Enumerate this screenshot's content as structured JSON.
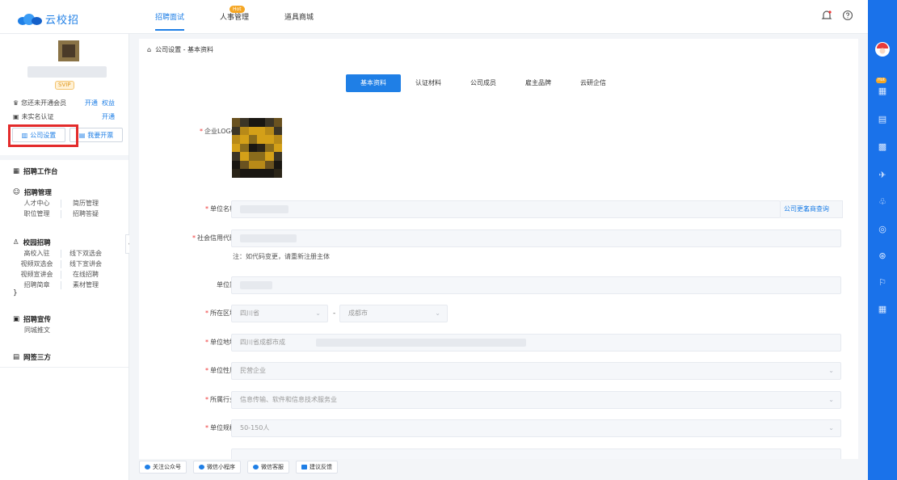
{
  "app": {
    "logo_text": "云校招"
  },
  "topnav": {
    "items": [
      {
        "label": "招聘面试",
        "active": true
      },
      {
        "label": "人事管理",
        "badge": "Hot"
      },
      {
        "label": "道具商城"
      }
    ]
  },
  "sidebar": {
    "svip_badge": "SVIP",
    "membership": {
      "label": "您还未开通会员",
      "action1": "开通",
      "action2": "权益"
    },
    "realname": {
      "label": "未实名认证",
      "action": "开通"
    },
    "btn_company": "公司设置",
    "btn_invoice": "我要开票",
    "sections": [
      {
        "title": "招聘工作台",
        "items": []
      },
      {
        "title": "招聘管理",
        "items": [
          "人才中心",
          "简历管理",
          "职位管理",
          "招聘答疑"
        ]
      },
      {
        "title": "校园招聘",
        "items": [
          "高校入驻",
          "线下双选会",
          "视频双选会",
          "线下宣讲会",
          "视频宣讲会",
          "在线招聘",
          "招聘简章",
          "素材管理"
        ]
      },
      {
        "title": "招聘宣传",
        "items": [
          "同城推文"
        ]
      },
      {
        "title": "网签三方",
        "items": []
      }
    ]
  },
  "breadcrumb": "公司设置 - 基本资料",
  "tabs": [
    {
      "label": "基本资料",
      "active": true
    },
    {
      "label": "认证材料"
    },
    {
      "label": "公司成员"
    },
    {
      "label": "雇主品牌"
    },
    {
      "label": "云研企信"
    }
  ],
  "form": {
    "logo_label": "企业LOGO",
    "name": {
      "label": "单位名称",
      "link1": "公司更名",
      "link2": "工商查询"
    },
    "credit": {
      "label": "社会信用代码",
      "hint": "注：如代码变更，请重新注册主体"
    },
    "short": {
      "label": "单位简"
    },
    "region": {
      "label": "所在区域",
      "province": "四川省",
      "city": "成都市",
      "sep": "-"
    },
    "address": {
      "label": "单位地址",
      "value": "四川省成都市成"
    },
    "nature": {
      "label": "单位性质",
      "value": "民营企业"
    },
    "industry": {
      "label": "所属行业",
      "value": "信息传输、软件和信息技术服务业"
    },
    "scale": {
      "label": "单位规模",
      "value": "50-150人"
    }
  },
  "footer": {
    "items": [
      "关注公众号",
      "微信小程序",
      "微信客服",
      "建议反馈"
    ]
  },
  "colors": {
    "primary": "#1f7fe6",
    "rightbar": "#1a72ea",
    "required": "#e33333",
    "highlight_box": "#e32b2b"
  }
}
